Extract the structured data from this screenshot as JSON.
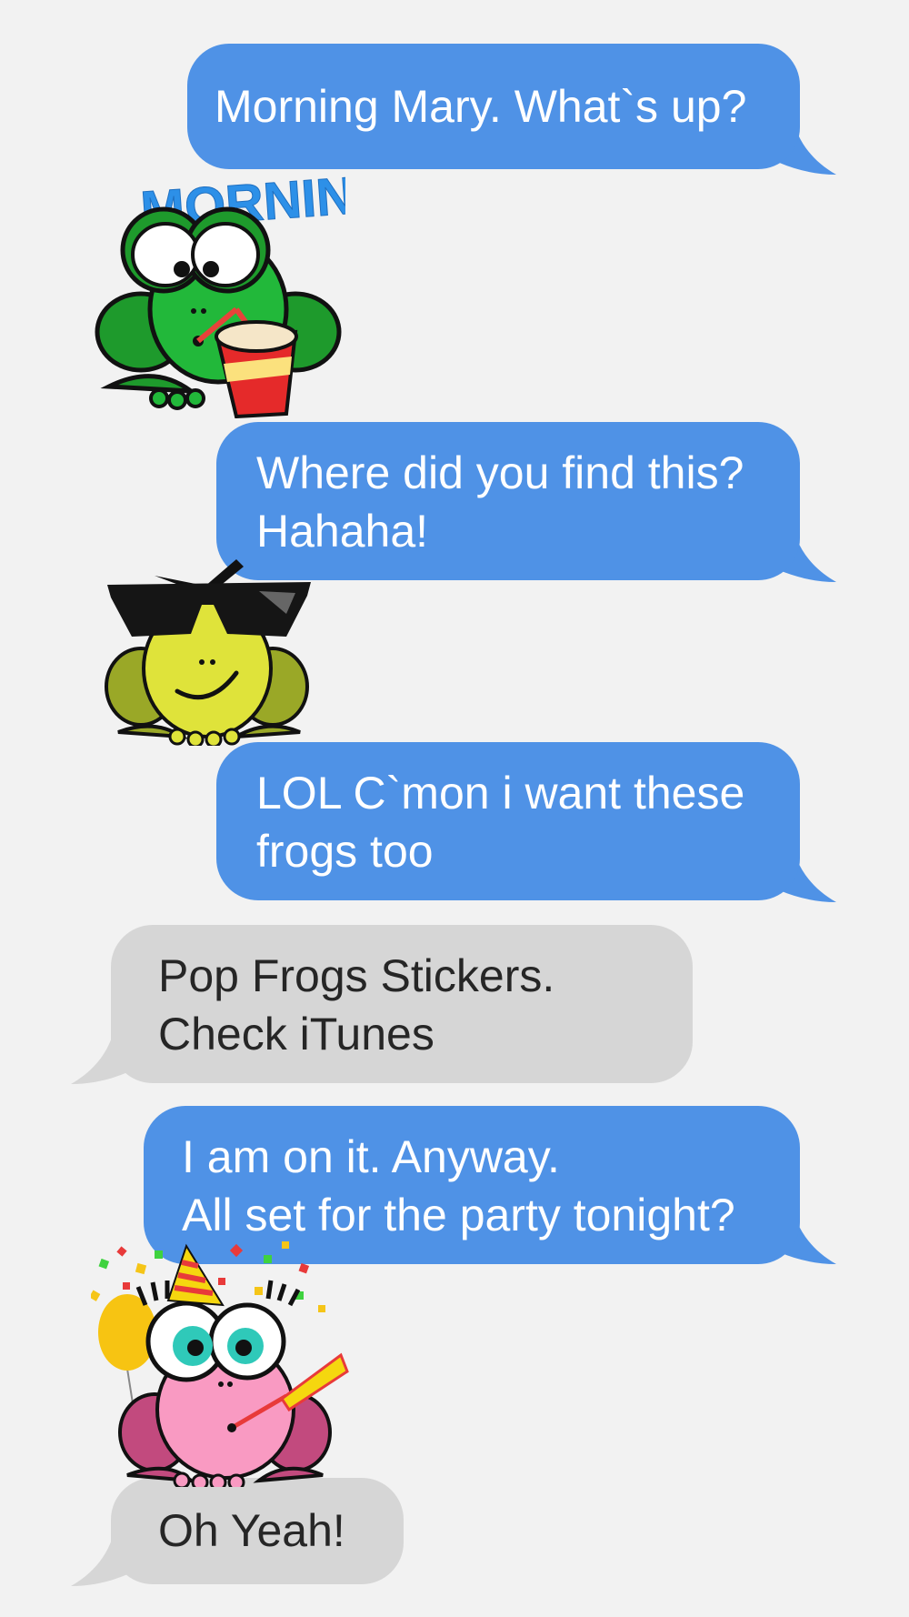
{
  "colors": {
    "background": "#f2f2f2",
    "sent_bubble": "#4f92e6",
    "received_bubble": "#d6d6d6",
    "sent_text": "#ffffff",
    "received_text": "#262626"
  },
  "messages": [
    {
      "direction": "sent",
      "lines": [
        "Morning Mary. What`s up?"
      ]
    },
    {
      "direction": "sticker",
      "sticker": "frog-morning-drink-sticker",
      "caption": "MORNING"
    },
    {
      "direction": "sent",
      "lines": [
        "Where did you find this?",
        "Hahaha!"
      ]
    },
    {
      "direction": "sticker",
      "sticker": "frog-sunglasses-sticker"
    },
    {
      "direction": "sent",
      "lines": [
        "LOL C`mon i want these",
        "frogs too"
      ]
    },
    {
      "direction": "received",
      "lines": [
        "Pop Frogs Stickers.",
        "Check iTunes"
      ]
    },
    {
      "direction": "sent",
      "lines": [
        "I am on it. Anyway.",
        "All set for the party tonight?"
      ]
    },
    {
      "direction": "sticker",
      "sticker": "frog-party-sticker"
    },
    {
      "direction": "received",
      "lines": [
        "Oh Yeah!"
      ]
    }
  ]
}
